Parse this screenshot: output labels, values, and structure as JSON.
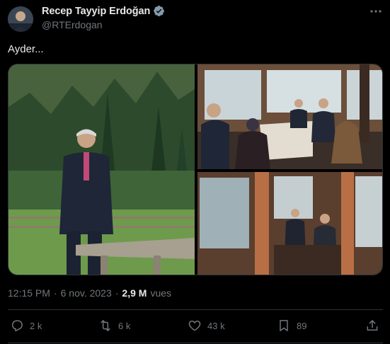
{
  "post": {
    "author_name": "Recep Tayyip Erdoğan",
    "handle": "@RTErdogan",
    "text": "Ayder...",
    "time": "12:15 PM",
    "separator": "·",
    "date": "6 nov. 2023",
    "views_count": "2,9 M",
    "views_label": "vues"
  },
  "actions": {
    "replies": "2 k",
    "reposts": "6 k",
    "likes": "43 k",
    "bookmarks": "89"
  },
  "icons": {
    "verified": "verified-badge-icon",
    "more": "more-icon",
    "reply": "reply-icon",
    "repost": "repost-icon",
    "like": "heart-icon",
    "bookmark": "bookmark-icon",
    "share": "share-icon"
  },
  "colors": {
    "background": "#000000",
    "text": "#e7e9ea",
    "secondary": "#71767b",
    "verified": "#829aab",
    "border": "#2f3336"
  }
}
